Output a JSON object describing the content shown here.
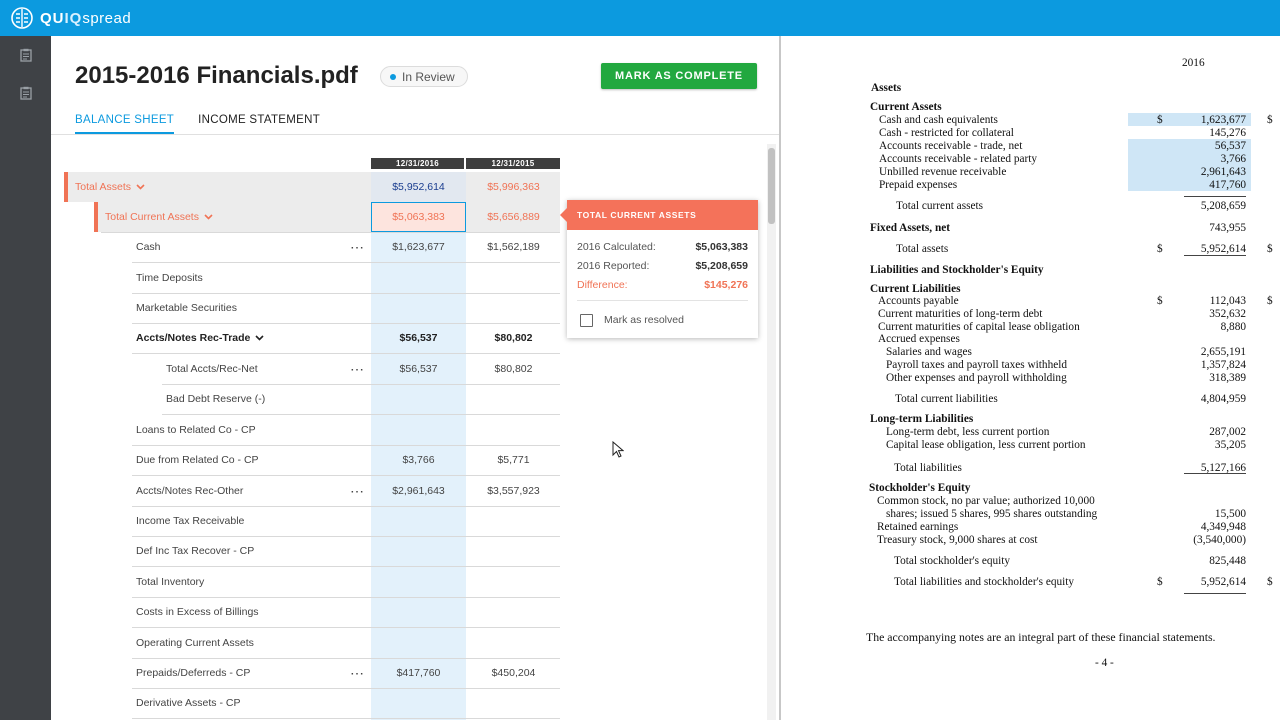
{
  "app": {
    "logo_a": "QU",
    "logo_b": "IQ",
    "logo_c": "spread"
  },
  "sidebar": {
    "icons": [
      "clipboard-icon",
      "clipboard-icon"
    ]
  },
  "header": {
    "title": "2015-2016 Financials.pdf",
    "status": "In Review",
    "complete_button": "MARK AS COMPLETE"
  },
  "tabs": [
    "BALANCE SHEET",
    "INCOME STATEMENT"
  ],
  "grid": {
    "columns": [
      "12/31/2016",
      "12/31/2015"
    ],
    "rows": [
      {
        "label": "Total Assets",
        "v2016": "$5,952,614",
        "v2015": "$5,996,363"
      },
      {
        "label": "Total Current Assets",
        "v2016": "$5,063,383",
        "v2015": "$5,656,889"
      },
      {
        "label": "Cash",
        "v2016": "$1,623,677",
        "v2015": "$1,562,189"
      },
      {
        "label": "Time Deposits",
        "v2016": "",
        "v2015": ""
      },
      {
        "label": "Marketable Securities",
        "v2016": "",
        "v2015": ""
      },
      {
        "label": "Accts/Notes Rec-Trade",
        "v2016": "$56,537",
        "v2015": "$80,802"
      },
      {
        "label": "Total Accts/Rec-Net",
        "v2016": "$56,537",
        "v2015": "$80,802"
      },
      {
        "label": "Bad Debt Reserve (-)",
        "v2016": "",
        "v2015": ""
      },
      {
        "label": "Loans to Related Co - CP",
        "v2016": "",
        "v2015": ""
      },
      {
        "label": "Due from Related Co - CP",
        "v2016": "$3,766",
        "v2015": "$5,771"
      },
      {
        "label": "Accts/Notes Rec-Other",
        "v2016": "$2,961,643",
        "v2015": "$3,557,923"
      },
      {
        "label": "Income Tax Receivable",
        "v2016": "",
        "v2015": ""
      },
      {
        "label": "Def Inc Tax Recover - CP",
        "v2016": "",
        "v2015": ""
      },
      {
        "label": "Total Inventory",
        "v2016": "",
        "v2015": ""
      },
      {
        "label": "Costs in Excess of Billings",
        "v2016": "",
        "v2015": ""
      },
      {
        "label": "Operating Current Assets",
        "v2016": "",
        "v2015": ""
      },
      {
        "label": "Prepaids/Deferreds - CP",
        "v2016": "$417,760",
        "v2015": "$450,204"
      },
      {
        "label": "Derivative Assets - CP",
        "v2016": "",
        "v2015": ""
      }
    ],
    "more_label": "⋯"
  },
  "callout": {
    "title": "TOTAL CURRENT ASSETS",
    "calc_label": "2016 Calculated:",
    "calc_value": "$5,063,383",
    "rep_label": "2016 Reported:",
    "rep_value": "$5,208,659",
    "diff_label": "Difference:",
    "diff_value": "$145,276",
    "resolve_label": "Mark as resolved"
  },
  "document": {
    "year": "2016",
    "lines": [
      {
        "t": "Assets",
        "b": true
      },
      {
        "t": "Current Assets",
        "b": true
      },
      {
        "t": "Cash and cash equivalents",
        "cur": "$",
        "v": "1,623,677",
        "hl": true
      },
      {
        "t": "Cash - restricted for collateral",
        "v": "145,276"
      },
      {
        "t": "Accounts receivable - trade, net",
        "v": "56,537",
        "hl": true
      },
      {
        "t": "Accounts receivable - related party",
        "v": "3,766",
        "hl": true
      },
      {
        "t": "Unbilled revenue receivable",
        "v": "2,961,643",
        "hl": true
      },
      {
        "t": "Prepaid expenses",
        "v": "417,760",
        "hl": true
      },
      {
        "t": "Total current assets",
        "v": "5,208,659"
      },
      {
        "t": "Fixed Assets, net",
        "b": true,
        "v": "743,955"
      },
      {
        "t": "Total assets",
        "cur": "$",
        "v": "5,952,614"
      },
      {
        "t": "Liabilities and Stockholder's Equity",
        "b": true
      },
      {
        "t": "Current Liabilities",
        "b": true
      },
      {
        "t": "Accounts payable",
        "cur": "$",
        "v": "112,043"
      },
      {
        "t": "Current maturities of long-term debt",
        "v": "352,632"
      },
      {
        "t": "Current maturities of capital lease obligation",
        "v": "8,880"
      },
      {
        "t": "Accrued expenses"
      },
      {
        "t": "Salaries and wages",
        "v": "2,655,191"
      },
      {
        "t": "Payroll taxes and payroll taxes withheld",
        "v": "1,357,824"
      },
      {
        "t": "Other expenses and payroll withholding",
        "v": "318,389"
      },
      {
        "t": "Total current liabilities",
        "v": "4,804,959"
      },
      {
        "t": "Long-term Liabilities",
        "b": true
      },
      {
        "t": "Long-term debt, less current portion",
        "v": "287,002"
      },
      {
        "t": "Capital lease obligation, less current portion",
        "v": "35,205"
      },
      {
        "t": "Total liabilities",
        "v": "5,127,166"
      },
      {
        "t": "Stockholder's Equity",
        "b": true
      },
      {
        "t": "Common stock, no par value; authorized 10,000"
      },
      {
        "t": "shares; issued 5 shares, 995 shares outstanding",
        "v": "15,500"
      },
      {
        "t": "Retained earnings",
        "v": "4,349,948"
      },
      {
        "t": "Treasury stock, 9,000 shares at cost",
        "v": "(3,540,000)"
      },
      {
        "t": "Total stockholder's equity",
        "v": "825,448"
      },
      {
        "t": "Total liabilities and stockholder's equity",
        "cur": "$",
        "v": "5,952,614"
      }
    ],
    "edge_dollar": "$",
    "footer": "The accompanying notes are an integral part of these financial statements.",
    "page": "- 4 -"
  },
  "colors": {
    "brand": "#0c9adf",
    "alert": "#f07355",
    "success": "#22a83f",
    "highlight": "#e3f1fb"
  }
}
